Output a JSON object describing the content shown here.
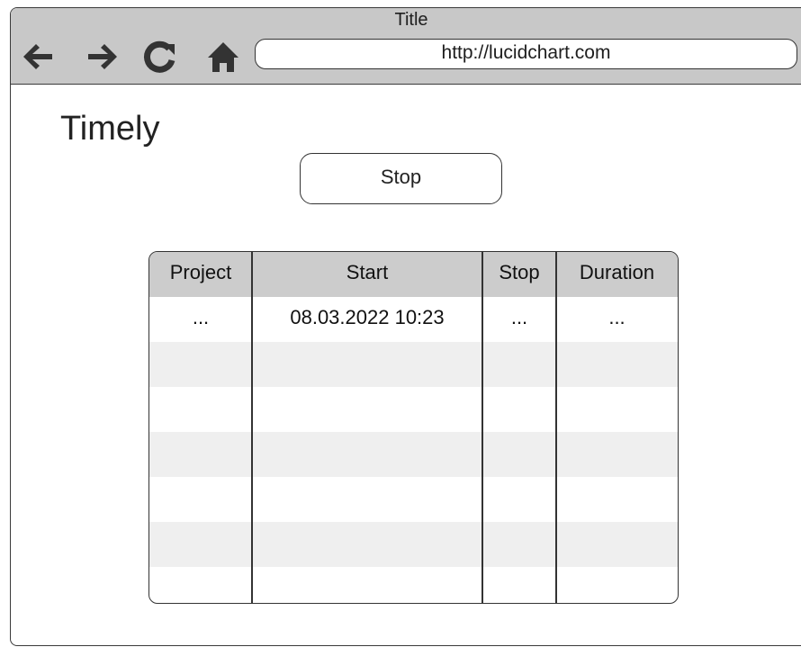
{
  "window": {
    "title": "Title",
    "url": "http://lucidchart.com"
  },
  "nav": {
    "back_icon": "arrow-left-icon",
    "forward_icon": "arrow-right-icon",
    "reload_icon": "reload-icon",
    "home_icon": "home-icon"
  },
  "app": {
    "title": "Timely",
    "stop_button_label": "Stop"
  },
  "table": {
    "columns": [
      "Project",
      "Start",
      "Stop",
      "Duration"
    ],
    "rows": [
      [
        "...",
        "08.03.2022 10:23",
        "...",
        "..."
      ],
      [
        "",
        "",
        "",
        ""
      ],
      [
        "",
        "",
        "",
        ""
      ],
      [
        "",
        "",
        "",
        ""
      ],
      [
        "",
        "",
        "",
        ""
      ],
      [
        "",
        "",
        "",
        ""
      ],
      [
        "",
        "",
        "",
        ""
      ]
    ]
  },
  "colors": {
    "titlebar": "#c8c8c8",
    "table_header": "#cccccc",
    "row_alt": "#efefef",
    "border": "#333333"
  }
}
